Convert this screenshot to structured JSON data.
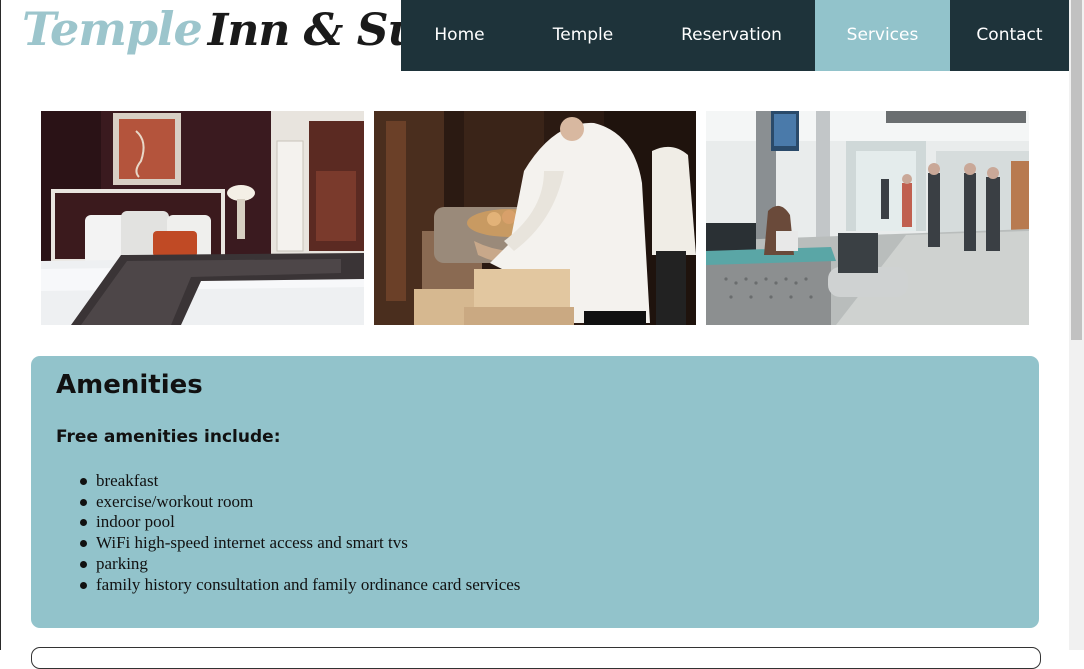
{
  "brand": {
    "name_part1": "Temple",
    "name_part2": "Inn & Suites",
    "color_part1": "#9cc5cc",
    "color_part2": "#1a1a1a"
  },
  "nav": {
    "items": [
      {
        "label": "Home"
      },
      {
        "label": "Temple"
      },
      {
        "label": "Reservation"
      },
      {
        "label": "Services",
        "active": true
      },
      {
        "label": "Contact"
      }
    ],
    "bg_color": "#1e333a",
    "active_color": "#92c3cb"
  },
  "gallery": [
    {
      "subject": "hotel-bedroom"
    },
    {
      "subject": "chef-breakfast-buffet"
    },
    {
      "subject": "hotel-lobby-front-desk"
    }
  ],
  "amenities": {
    "title": "Amenities",
    "subtitle": "Free amenities include:",
    "items": [
      "breakfast",
      "exercise/workout room",
      "indoor pool",
      "WiFi high-speed internet access and smart tvs",
      "parking",
      "family history consultation and family ordinance card services"
    ],
    "bg_color": "#92c3cb"
  }
}
